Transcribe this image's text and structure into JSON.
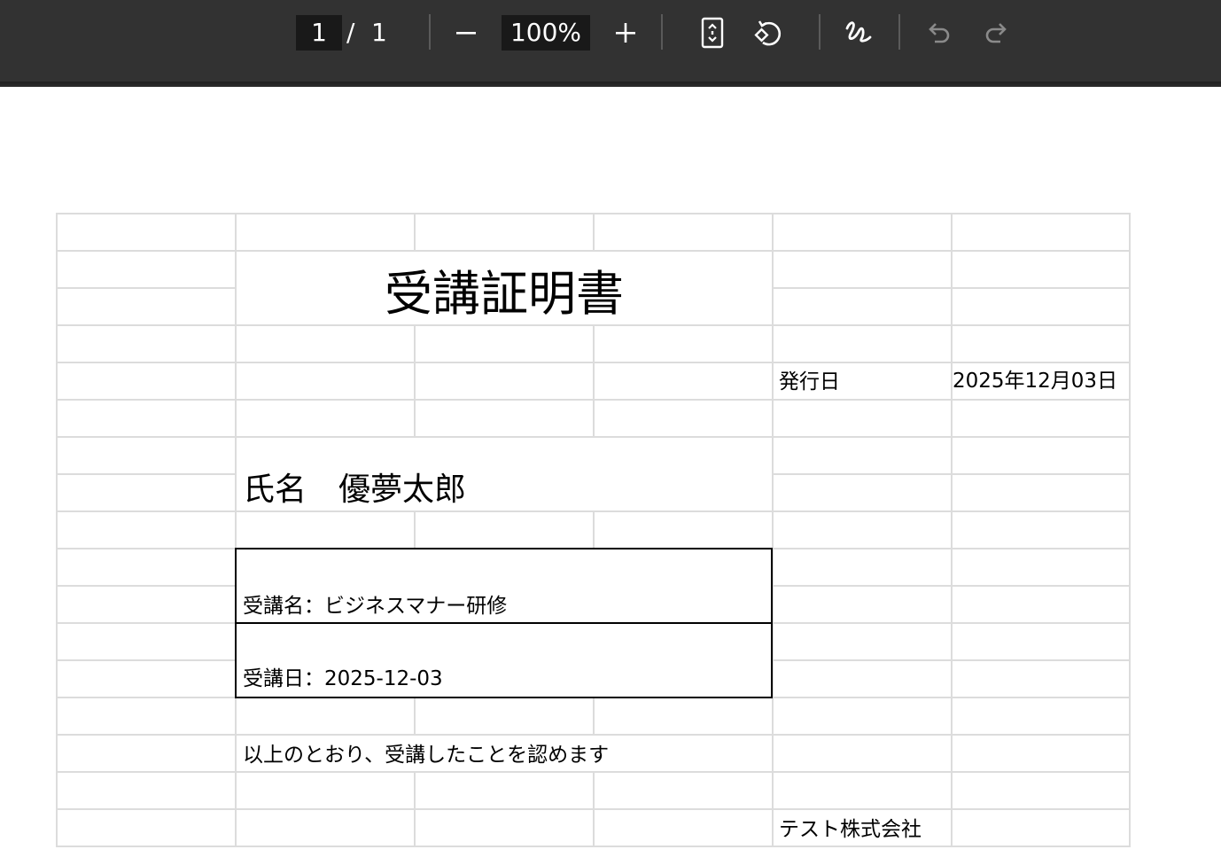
{
  "toolbar": {
    "page_current": "1",
    "page_separator": "/",
    "page_total": "1",
    "zoom_out_label": "−",
    "zoom_value": "100%",
    "zoom_in_label": "+",
    "icons": {
      "fit_page": "fit-page-icon",
      "rotate": "rotate-icon",
      "annotate": "draw-icon",
      "undo": "undo-icon",
      "redo": "redo-icon"
    }
  },
  "document": {
    "title": "受講証明書",
    "issue_label": "発行日",
    "issue_date": "2025年12月03日",
    "name_line": "氏名　優夢太郎",
    "course_line": "受講名：ビジネスマナー研修",
    "date_line": "受講日：2025-12-03",
    "statement": "以上のとおり、受講したことを認めます",
    "company": "テスト株式会社"
  },
  "colors": {
    "toolbar_bg": "#323232",
    "input_bg": "#191919",
    "grid_line": "#dcdcdc",
    "border": "#000000",
    "disabled_icon": "#8a8a8a"
  }
}
